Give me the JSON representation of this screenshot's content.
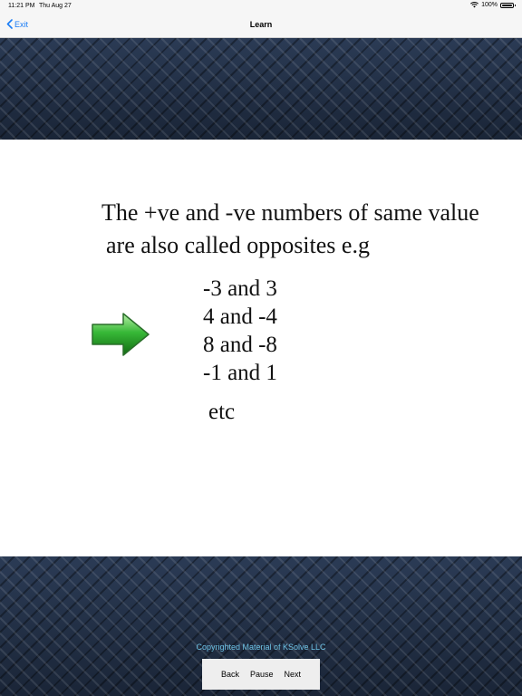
{
  "status_bar": {
    "time": "11:21 PM",
    "date": "Thu Aug 27",
    "battery": "100%",
    "icons": [
      "wifi-icon",
      "battery-icon"
    ]
  },
  "nav": {
    "back_label": "Exit",
    "title": "Learn"
  },
  "slide": {
    "line1": "The +ve and -ve numbers of same value",
    "line2": "are also called opposites e.g",
    "examples": [
      "-3 and 3",
      "4 and -4",
      "8 and -8",
      "-1 and 1"
    ],
    "etc": "etc",
    "arrow_icon": "green-arrow-right-icon"
  },
  "footer": {
    "copyright": "Copyrighted Material of KSolve LLC",
    "back_label": "Back",
    "pause_label": "Pause",
    "next_label": "Next"
  },
  "colors": {
    "accent_link": "#1a7cf5",
    "arrow_green": "#2fae2f",
    "copyright_text": "#6ec3e6"
  }
}
